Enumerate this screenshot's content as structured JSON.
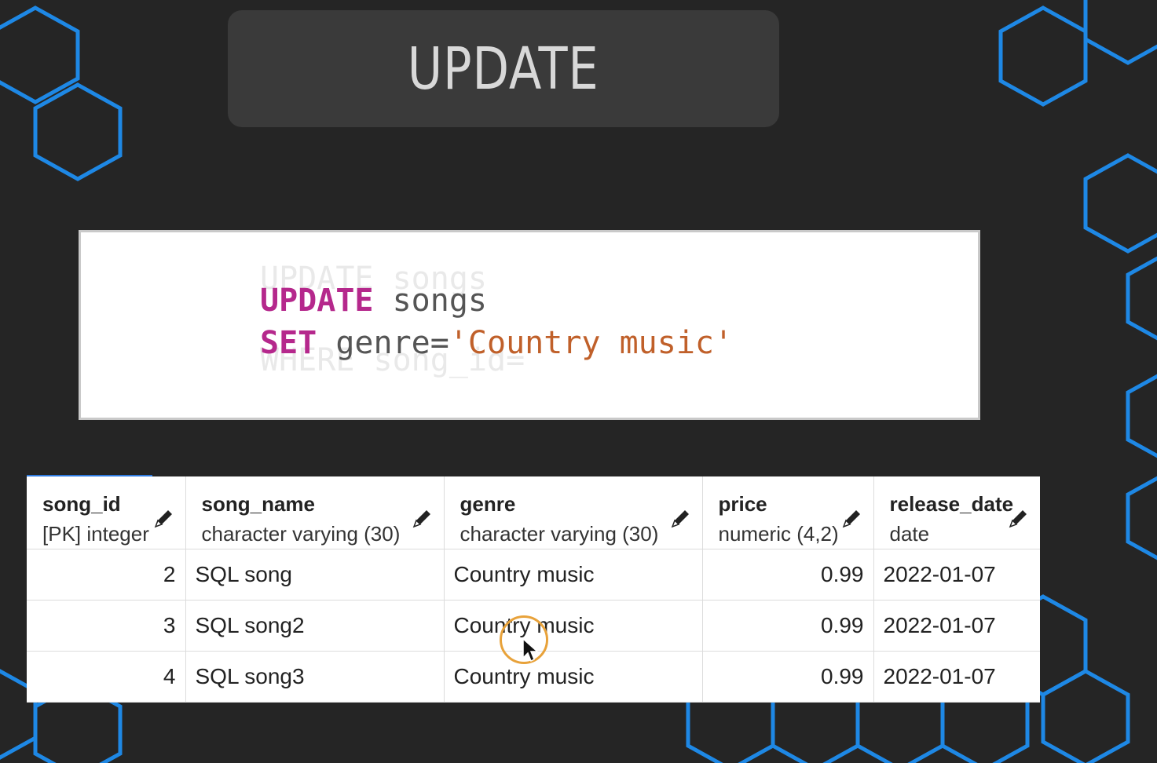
{
  "slide": {
    "title": "UPDATE",
    "background_color": "#252525",
    "accent_color": "#1e88e5"
  },
  "code": {
    "line1_keyword": "UPDATE",
    "line1_rest": " songs",
    "line2_keyword": "SET",
    "line2_plain": " genre=",
    "line2_string": "'Country music'",
    "keyword_color": "#b5288c",
    "string_color": "#c0602a"
  },
  "table": {
    "columns": [
      {
        "name": "song_id",
        "type": "[PK] integer"
      },
      {
        "name": "song_name",
        "type": "character varying (30)"
      },
      {
        "name": "genre",
        "type": "character varying (30)"
      },
      {
        "name": "price",
        "type": "numeric (4,2)"
      },
      {
        "name": "release_date",
        "type": "date"
      }
    ],
    "rows": [
      {
        "song_id": "2",
        "song_name": "SQL song",
        "genre": "Country music",
        "price": "0.99",
        "release_date": "2022-01-07"
      },
      {
        "song_id": "3",
        "song_name": "SQL song2",
        "genre": "Country music",
        "price": "0.99",
        "release_date": "2022-01-07"
      },
      {
        "song_id": "4",
        "song_name": "SQL song3",
        "genre": "Country music",
        "price": "0.99",
        "release_date": "2022-01-07"
      }
    ]
  }
}
